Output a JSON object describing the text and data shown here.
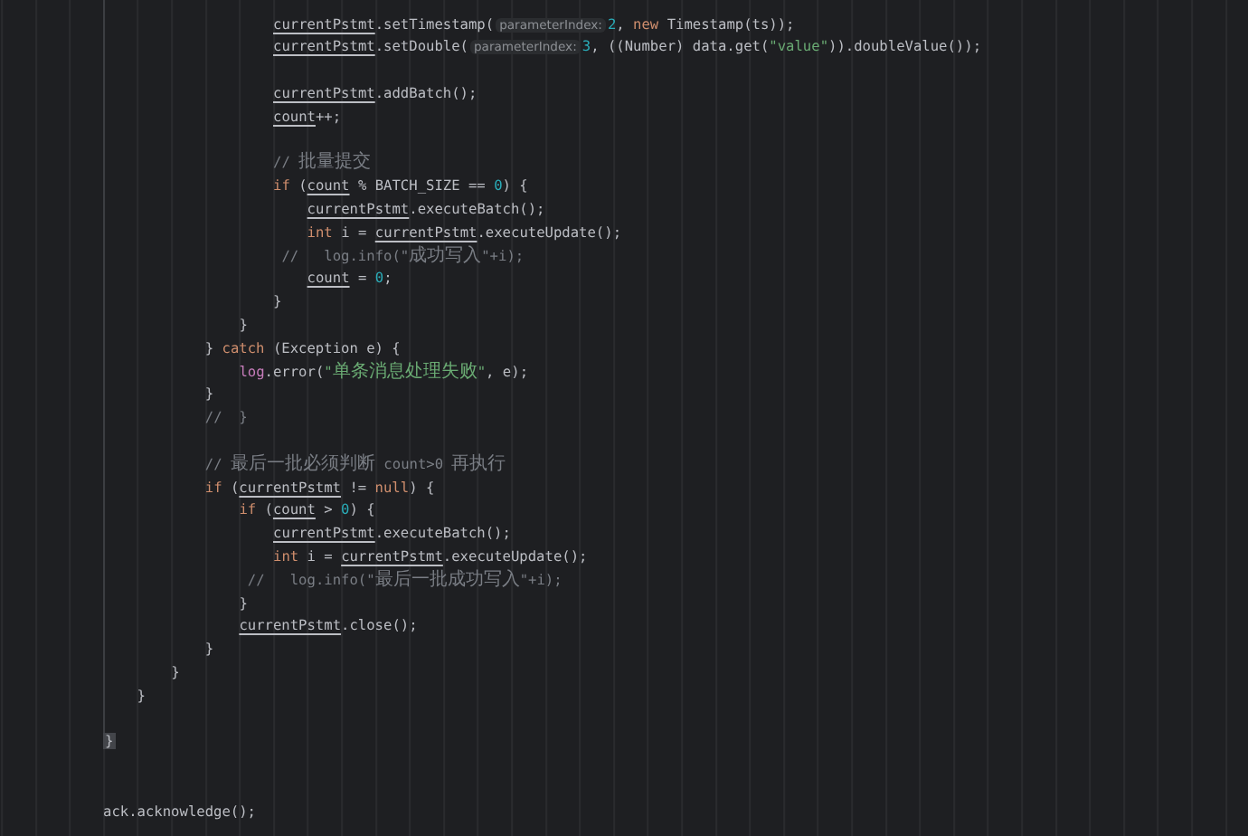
{
  "editor": {
    "lines": [
      {
        "kind": "code",
        "tokens": [
          {
            "kind": "var",
            "text": "                    currentPstmt"
          },
          {
            "kind": "plain",
            "text": ".setTimestamp("
          },
          {
            "kind": "hint",
            "text": "parameterIndex:"
          },
          {
            "kind": "number",
            "text": "2"
          },
          {
            "kind": "plain",
            "text": ", "
          },
          {
            "kind": "keyword",
            "text": "new"
          },
          {
            "kind": "plain",
            "text": " Timestamp(ts));"
          }
        ]
      },
      {
        "kind": "code",
        "tokens": [
          {
            "kind": "var",
            "text": "                    currentPstmt"
          },
          {
            "kind": "plain",
            "text": ".setDouble("
          },
          {
            "kind": "hint",
            "text": "parameterIndex:"
          },
          {
            "kind": "number",
            "text": "3"
          },
          {
            "kind": "plain",
            "text": ", ((Number) data.get("
          },
          {
            "kind": "string",
            "text": "\"value\""
          },
          {
            "kind": "plain",
            "text": ")).doubleValue());"
          }
        ]
      },
      {
        "kind": "blank"
      },
      {
        "kind": "code",
        "tokens": [
          {
            "kind": "var",
            "text": "                    currentPstmt"
          },
          {
            "kind": "plain",
            "text": ".addBatch();"
          }
        ]
      },
      {
        "kind": "code",
        "tokens": [
          {
            "kind": "var",
            "text": "                    count"
          },
          {
            "kind": "plain",
            "text": "++;"
          }
        ]
      },
      {
        "kind": "blank"
      },
      {
        "kind": "code",
        "tokens": [
          {
            "kind": "comment",
            "text": "                    // "
          },
          {
            "kind": "comment-cjk",
            "text": "批量提交"
          }
        ]
      },
      {
        "kind": "code",
        "tokens": [
          {
            "kind": "keyword",
            "text": "                    if"
          },
          {
            "kind": "plain",
            "text": " ("
          },
          {
            "kind": "var",
            "text": "count"
          },
          {
            "kind": "plain",
            "text": " % BATCH_SIZE == "
          },
          {
            "kind": "number",
            "text": "0"
          },
          {
            "kind": "plain",
            "text": ") {"
          }
        ]
      },
      {
        "kind": "code",
        "tokens": [
          {
            "kind": "var",
            "text": "                        currentPstmt"
          },
          {
            "kind": "plain",
            "text": ".executeBatch();"
          }
        ]
      },
      {
        "kind": "code",
        "tokens": [
          {
            "kind": "keyword",
            "text": "                        int"
          },
          {
            "kind": "plain",
            "text": " i = "
          },
          {
            "kind": "var",
            "text": "currentPstmt"
          },
          {
            "kind": "plain",
            "text": ".executeUpdate();"
          }
        ]
      },
      {
        "kind": "code",
        "tokens": [
          {
            "kind": "comment",
            "text": "                     //   log.info(\""
          },
          {
            "kind": "comment-cjk",
            "text": "成功写入"
          },
          {
            "kind": "comment",
            "text": "\"+i);"
          }
        ]
      },
      {
        "kind": "code",
        "tokens": [
          {
            "kind": "var",
            "text": "                        count"
          },
          {
            "kind": "plain",
            "text": " = "
          },
          {
            "kind": "number",
            "text": "0"
          },
          {
            "kind": "plain",
            "text": ";"
          }
        ]
      },
      {
        "kind": "code",
        "tokens": [
          {
            "kind": "plain",
            "text": "                    }"
          }
        ]
      },
      {
        "kind": "code",
        "tokens": [
          {
            "kind": "plain",
            "text": "                }"
          }
        ]
      },
      {
        "kind": "code",
        "tokens": [
          {
            "kind": "plain",
            "text": "            } "
          },
          {
            "kind": "keyword",
            "text": "catch"
          },
          {
            "kind": "plain",
            "text": " (Exception e) {"
          }
        ]
      },
      {
        "kind": "code",
        "tokens": [
          {
            "kind": "field",
            "text": "                log"
          },
          {
            "kind": "plain",
            "text": ".error("
          },
          {
            "kind": "string",
            "text": "\""
          },
          {
            "kind": "string-cjk",
            "text": "单条消息处理失败"
          },
          {
            "kind": "string",
            "text": "\""
          },
          {
            "kind": "plain",
            "text": ", e);"
          }
        ]
      },
      {
        "kind": "code",
        "tokens": [
          {
            "kind": "plain",
            "text": "            }"
          }
        ]
      },
      {
        "kind": "code",
        "tokens": [
          {
            "kind": "comment",
            "text": "            //  }"
          }
        ]
      },
      {
        "kind": "blank"
      },
      {
        "kind": "code",
        "tokens": [
          {
            "kind": "comment",
            "text": "            // "
          },
          {
            "kind": "comment-cjk",
            "text": "最后一批必须判断"
          },
          {
            "kind": "comment",
            "text": " count>0 "
          },
          {
            "kind": "comment-cjk",
            "text": "再执行"
          }
        ]
      },
      {
        "kind": "code",
        "tokens": [
          {
            "kind": "keyword",
            "text": "            if"
          },
          {
            "kind": "plain",
            "text": " ("
          },
          {
            "kind": "var",
            "text": "currentPstmt"
          },
          {
            "kind": "plain",
            "text": " != "
          },
          {
            "kind": "keyword",
            "text": "null"
          },
          {
            "kind": "plain",
            "text": ") {"
          }
        ]
      },
      {
        "kind": "code",
        "tokens": [
          {
            "kind": "keyword",
            "text": "                if"
          },
          {
            "kind": "plain",
            "text": " ("
          },
          {
            "kind": "var",
            "text": "count"
          },
          {
            "kind": "plain",
            "text": " > "
          },
          {
            "kind": "number",
            "text": "0"
          },
          {
            "kind": "plain",
            "text": ") {"
          }
        ]
      },
      {
        "kind": "code",
        "tokens": [
          {
            "kind": "var",
            "text": "                    currentPstmt"
          },
          {
            "kind": "plain",
            "text": ".executeBatch();"
          }
        ]
      },
      {
        "kind": "code",
        "tokens": [
          {
            "kind": "keyword",
            "text": "                    int"
          },
          {
            "kind": "plain",
            "text": " i = "
          },
          {
            "kind": "var",
            "text": "currentPstmt"
          },
          {
            "kind": "plain",
            "text": ".executeUpdate();"
          }
        ]
      },
      {
        "kind": "code",
        "tokens": [
          {
            "kind": "comment",
            "text": "                 //   log.info(\""
          },
          {
            "kind": "comment-cjk",
            "text": "最后一批成功写入"
          },
          {
            "kind": "comment",
            "text": "\"+i);"
          }
        ]
      },
      {
        "kind": "code",
        "tokens": [
          {
            "kind": "plain",
            "text": "                }"
          }
        ]
      },
      {
        "kind": "code",
        "tokens": [
          {
            "kind": "var",
            "text": "                currentPstmt"
          },
          {
            "kind": "plain",
            "text": ".close();"
          }
        ]
      },
      {
        "kind": "code",
        "tokens": [
          {
            "kind": "plain",
            "text": "            }"
          }
        ]
      },
      {
        "kind": "code",
        "tokens": [
          {
            "kind": "plain",
            "text": "        }"
          }
        ]
      },
      {
        "kind": "code",
        "tokens": [
          {
            "kind": "plain",
            "text": "    }"
          }
        ]
      },
      {
        "kind": "blank"
      },
      {
        "kind": "code",
        "tokens": [
          {
            "kind": "brace-match",
            "text": "}"
          }
        ]
      },
      {
        "kind": "blank"
      },
      {
        "kind": "blank"
      },
      {
        "kind": "code",
        "tokens": [
          {
            "kind": "plain",
            "text": "ack.acknowledge();"
          }
        ]
      }
    ]
  }
}
